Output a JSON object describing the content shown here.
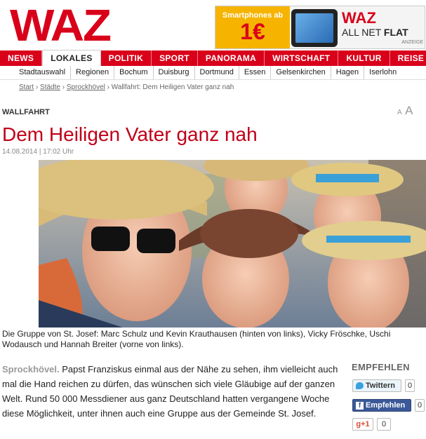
{
  "logo": "WAZ",
  "ad": {
    "line1": "Smartphones ab",
    "price": "1€",
    "brand": "WAZ",
    "tag_pre": "ALL NET ",
    "tag_bold": "FLAT",
    "note": "ANZEIGE"
  },
  "nav": [
    "NEWS",
    "LOKALES",
    "POLITIK",
    "SPORT",
    "PANORAMA",
    "WIRTSCHAFT",
    "KULTUR",
    "REISE"
  ],
  "subnav": [
    "Stadtauswahl",
    "Regionen",
    "Bochum",
    "Duisburg",
    "Dortmund",
    "Essen",
    "Gelsenkirchen",
    "Hagen",
    "Iserlohn"
  ],
  "breadcrumb": {
    "items": [
      "Start",
      "Städte",
      "Sprockhövel"
    ],
    "sep": "›",
    "current": "Wallfahrt: Dem Heiligen Vater ganz nah"
  },
  "article": {
    "kicker": "WALLFAHRT",
    "font_small": "A",
    "font_large": "A",
    "title": "Dem Heiligen Vater ganz nah",
    "dateline": "14.08.2014 | 17:02 Uhr",
    "caption": "Die Gruppe von St. Josef: Marc Schulz und Kevin Krauthausen (hinten von links), Vicky Fröschke, Uschi Wodausch und Hannah Breiter (vorne von links).",
    "location": "Sprockhövel.",
    "lead": " Papst Franziskus einmal aus der Nähe zu sehen, ihm viel­leicht auch mal die Hand reichen zu dürfen, das wünschen sich viele Gläubi­ge auf der ganzen Welt. Rund 50 000 Messdiener aus ganz Deutschland hatten vergangene Woche diese Möglichkeit, unter ihnen auch eine Gruppe aus der Gemeinde St. Josef."
  },
  "share": {
    "title": "EMPFEHLEN",
    "twitter": "Twittern",
    "twitter_count": "0",
    "facebook": "Empfehlen",
    "facebook_count": "0",
    "gplus": "g+1",
    "gplus_count": "0"
  }
}
